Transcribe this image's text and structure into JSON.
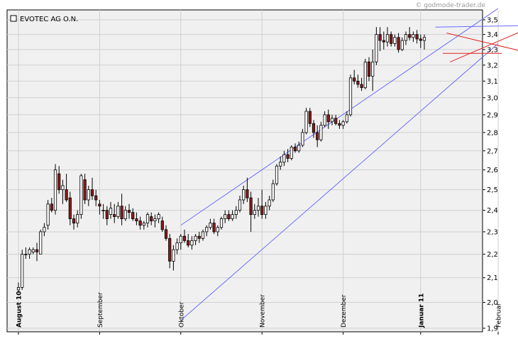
{
  "chart_data": {
    "type": "candlestick",
    "title": "EVOTEC AG O.N.",
    "watermark": "© godmode-trader.de",
    "y_ticks": [
      "3,5",
      "3,4",
      "3,3",
      "3,2",
      "3,1",
      "3,0",
      "2,9",
      "2,8",
      "2,7",
      "2,6",
      "2,5",
      "2,4",
      "2,3",
      "2,2",
      "2,1",
      "2,0",
      "1,9"
    ],
    "y_values": [
      3.5,
      3.4,
      3.3,
      3.2,
      3.1,
      3.0,
      2.9,
      2.8,
      2.7,
      2.6,
      2.5,
      2.4,
      2.3,
      2.2,
      2.1,
      2.0,
      1.9
    ],
    "ylim": [
      1.9,
      3.5
    ],
    "scale": "log",
    "x_ticks": [
      {
        "label": "August 10",
        "bold": true,
        "index": 0
      },
      {
        "label": "September",
        "bold": false,
        "index": 22
      },
      {
        "label": "Oktober",
        "bold": false,
        "index": 44
      },
      {
        "label": "November",
        "bold": false,
        "index": 66
      },
      {
        "label": "Dezember",
        "bold": false,
        "index": 88
      },
      {
        "label": "Januar 11",
        "bold": true,
        "index": 109
      },
      {
        "label": "Februar",
        "bold": false,
        "index": 130
      }
    ],
    "colors": {
      "up": "#ffffff",
      "down": "#8b1a1a",
      "wick": "#000000",
      "channel": "#6b6bff",
      "pattern": "#e02020",
      "grid": "#cfcfcf",
      "bg": "#f0f0f0"
    },
    "candles": [
      [
        2.05,
        2.08,
        2.04,
        2.06
      ],
      [
        2.06,
        2.22,
        2.05,
        2.2
      ],
      [
        2.2,
        2.23,
        2.18,
        2.2
      ],
      [
        2.2,
        2.23,
        2.18,
        2.22
      ],
      [
        2.21,
        2.23,
        2.2,
        2.22
      ],
      [
        2.22,
        2.25,
        2.17,
        2.21
      ],
      [
        2.2,
        2.31,
        2.2,
        2.3
      ],
      [
        2.3,
        2.34,
        2.28,
        2.32
      ],
      [
        2.33,
        2.45,
        2.31,
        2.43
      ],
      [
        2.43,
        2.46,
        2.39,
        2.4
      ],
      [
        2.4,
        2.63,
        2.38,
        2.6
      ],
      [
        2.58,
        2.62,
        2.48,
        2.5
      ],
      [
        2.5,
        2.55,
        2.43,
        2.52
      ],
      [
        2.5,
        2.58,
        2.44,
        2.45
      ],
      [
        2.46,
        2.49,
        2.33,
        2.36
      ],
      [
        2.36,
        2.38,
        2.31,
        2.34
      ],
      [
        2.34,
        2.4,
        2.32,
        2.38
      ],
      [
        2.38,
        2.58,
        2.36,
        2.57
      ],
      [
        2.55,
        2.58,
        2.43,
        2.45
      ],
      [
        2.45,
        2.52,
        2.42,
        2.5
      ],
      [
        2.5,
        2.56,
        2.45,
        2.47
      ],
      [
        2.47,
        2.5,
        2.42,
        2.45
      ],
      [
        2.43,
        2.45,
        2.38,
        2.42
      ],
      [
        2.4,
        2.43,
        2.36,
        2.4
      ],
      [
        2.4,
        2.42,
        2.33,
        2.36
      ],
      [
        2.38,
        2.44,
        2.36,
        2.41
      ],
      [
        2.38,
        2.43,
        2.34,
        2.37
      ],
      [
        2.37,
        2.44,
        2.36,
        2.42
      ],
      [
        2.42,
        2.48,
        2.33,
        2.36
      ],
      [
        2.36,
        2.42,
        2.35,
        2.4
      ],
      [
        2.4,
        2.43,
        2.36,
        2.39
      ],
      [
        2.39,
        2.41,
        2.35,
        2.36
      ],
      [
        2.36,
        2.39,
        2.33,
        2.35
      ],
      [
        2.35,
        2.37,
        2.31,
        2.33
      ],
      [
        2.33,
        2.35,
        2.31,
        2.34
      ],
      [
        2.34,
        2.39,
        2.32,
        2.38
      ],
      [
        2.37,
        2.39,
        2.33,
        2.35
      ],
      [
        2.35,
        2.38,
        2.32,
        2.36
      ],
      [
        2.36,
        2.39,
        2.34,
        2.38
      ],
      [
        2.35,
        2.37,
        2.3,
        2.31
      ],
      [
        2.31,
        2.33,
        2.26,
        2.27
      ],
      [
        2.27,
        2.29,
        2.14,
        2.17
      ],
      [
        2.17,
        2.24,
        2.13,
        2.22
      ],
      [
        2.22,
        2.27,
        2.2,
        2.25
      ],
      [
        2.25,
        2.29,
        2.22,
        2.28
      ],
      [
        2.28,
        2.31,
        2.25,
        2.26
      ],
      [
        2.26,
        2.29,
        2.23,
        2.24
      ],
      [
        2.24,
        2.28,
        2.22,
        2.26
      ],
      [
        2.26,
        2.29,
        2.24,
        2.28
      ],
      [
        2.28,
        2.3,
        2.25,
        2.27
      ],
      [
        2.27,
        2.31,
        2.26,
        2.3
      ],
      [
        2.3,
        2.33,
        2.28,
        2.32
      ],
      [
        2.32,
        2.36,
        2.31,
        2.34
      ],
      [
        2.34,
        2.36,
        2.29,
        2.3
      ],
      [
        2.3,
        2.33,
        2.28,
        2.32
      ],
      [
        2.32,
        2.37,
        2.31,
        2.36
      ],
      [
        2.36,
        2.4,
        2.34,
        2.38
      ],
      [
        2.38,
        2.4,
        2.35,
        2.36
      ],
      [
        2.36,
        2.4,
        2.35,
        2.38
      ],
      [
        2.38,
        2.42,
        2.36,
        2.4
      ],
      [
        2.4,
        2.47,
        2.39,
        2.45
      ],
      [
        2.45,
        2.52,
        2.43,
        2.5
      ],
      [
        2.5,
        2.56,
        2.44,
        2.46
      ],
      [
        2.46,
        2.49,
        2.3,
        2.38
      ],
      [
        2.38,
        2.43,
        2.36,
        2.4
      ],
      [
        2.4,
        2.46,
        2.37,
        2.42
      ],
      [
        2.42,
        2.5,
        2.36,
        2.38
      ],
      [
        2.38,
        2.44,
        2.36,
        2.42
      ],
      [
        2.42,
        2.47,
        2.4,
        2.45
      ],
      [
        2.45,
        2.55,
        2.44,
        2.53
      ],
      [
        2.53,
        2.63,
        2.52,
        2.62
      ],
      [
        2.62,
        2.67,
        2.6,
        2.64
      ],
      [
        2.64,
        2.7,
        2.62,
        2.68
      ],
      [
        2.68,
        2.71,
        2.64,
        2.66
      ],
      [
        2.66,
        2.73,
        2.65,
        2.72
      ],
      [
        2.72,
        2.74,
        2.69,
        2.7
      ],
      [
        2.7,
        2.75,
        2.69,
        2.73
      ],
      [
        2.73,
        2.82,
        2.72,
        2.8
      ],
      [
        2.8,
        2.94,
        2.79,
        2.92
      ],
      [
        2.92,
        2.94,
        2.83,
        2.85
      ],
      [
        2.85,
        2.87,
        2.77,
        2.8
      ],
      [
        2.8,
        2.84,
        2.72,
        2.76
      ],
      [
        2.76,
        2.86,
        2.75,
        2.84
      ],
      [
        2.84,
        2.92,
        2.83,
        2.9
      ],
      [
        2.9,
        2.93,
        2.82,
        2.86
      ],
      [
        2.86,
        2.9,
        2.84,
        2.88
      ],
      [
        2.88,
        2.9,
        2.84,
        2.85
      ],
      [
        2.85,
        2.87,
        2.82,
        2.84
      ],
      [
        2.84,
        2.87,
        2.82,
        2.86
      ],
      [
        2.86,
        2.92,
        2.85,
        2.9
      ],
      [
        2.9,
        3.14,
        2.89,
        3.12
      ],
      [
        3.12,
        3.17,
        3.08,
        3.1
      ],
      [
        3.1,
        3.14,
        3.06,
        3.08
      ],
      [
        3.08,
        3.12,
        3.04,
        3.06
      ],
      [
        3.06,
        3.24,
        3.05,
        3.22
      ],
      [
        3.22,
        3.25,
        3.1,
        3.13
      ],
      [
        3.13,
        3.3,
        3.04,
        3.22
      ],
      [
        3.22,
        3.45,
        3.2,
        3.4
      ],
      [
        3.4,
        3.45,
        3.29,
        3.36
      ],
      [
        3.36,
        3.42,
        3.3,
        3.35
      ],
      [
        3.35,
        3.45,
        3.32,
        3.4
      ],
      [
        3.4,
        3.42,
        3.32,
        3.34
      ],
      [
        3.34,
        3.4,
        3.32,
        3.38
      ],
      [
        3.38,
        3.41,
        3.28,
        3.3
      ],
      [
        3.3,
        3.38,
        3.29,
        3.36
      ],
      [
        3.36,
        3.42,
        3.33,
        3.4
      ],
      [
        3.4,
        3.45,
        3.36,
        3.38
      ],
      [
        3.38,
        3.42,
        3.35,
        3.4
      ],
      [
        3.4,
        3.43,
        3.34,
        3.37
      ],
      [
        3.37,
        3.4,
        3.31,
        3.36
      ],
      [
        3.36,
        3.4,
        3.3,
        3.38
      ]
    ],
    "channel_lower": [
      [
        44,
        1.93
      ],
      [
        130,
        3.34
      ]
    ],
    "channel_upper": [
      [
        44,
        2.33
      ],
      [
        130,
        3.58
      ]
    ],
    "pattern_lines": [
      {
        "p1": [
          116,
          3.41
        ],
        "p2": [
          138,
          3.28
        ]
      },
      {
        "p1": [
          117,
          3.22
        ],
        "p2": [
          138,
          3.44
        ]
      },
      {
        "p1": [
          115,
          3.275
        ],
        "p2": [
          131,
          3.275
        ]
      }
    ],
    "blue_flat": {
      "p1": [
        113,
        3.45
      ],
      "p2": [
        136,
        3.46
      ]
    }
  }
}
